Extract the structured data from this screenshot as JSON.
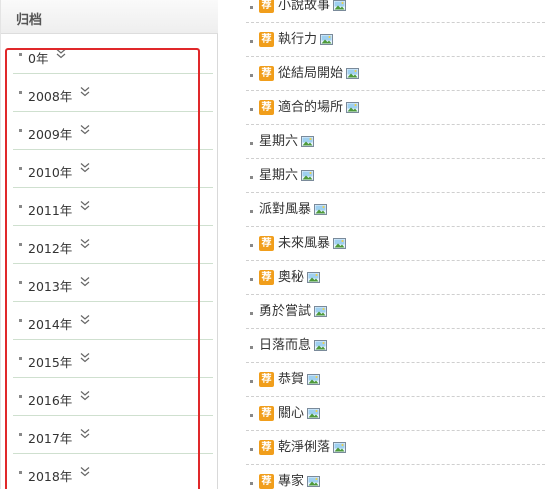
{
  "sidebar": {
    "title": "归档",
    "years": [
      "0年",
      "2008年",
      "2009年",
      "2010年",
      "2011年",
      "2012年",
      "2013年",
      "2014年",
      "2015年",
      "2016年",
      "2017年",
      "2018年"
    ]
  },
  "posts": [
    {
      "title": "小說故事",
      "recommended": true,
      "badge": "荐"
    },
    {
      "title": "執行力",
      "recommended": true,
      "badge": "荐"
    },
    {
      "title": "從結局開始",
      "recommended": true,
      "badge": "荐"
    },
    {
      "title": "適合的場所",
      "recommended": true,
      "badge": "荐"
    },
    {
      "title": "星期六",
      "recommended": false
    },
    {
      "title": "星期六",
      "recommended": false
    },
    {
      "title": "派對風暴",
      "recommended": false
    },
    {
      "title": "未來風暴",
      "recommended": true,
      "badge": "荐"
    },
    {
      "title": "奧秘",
      "recommended": true,
      "badge": "荐"
    },
    {
      "title": "勇於嘗試",
      "recommended": false
    },
    {
      "title": "日落而息",
      "recommended": false
    },
    {
      "title": "恭賀",
      "recommended": true,
      "badge": "荐"
    },
    {
      "title": "關心",
      "recommended": true,
      "badge": "荐"
    },
    {
      "title": "乾淨俐落",
      "recommended": true,
      "badge": "荐"
    },
    {
      "title": "專家",
      "recommended": true,
      "badge": "荐"
    }
  ],
  "colors": {
    "badge": "#f19e1b",
    "highlight": "#e0282a",
    "divider": "#cfe0cf"
  },
  "icons": {
    "expand": "chevron-double-down-icon",
    "attachment": "image-icon"
  }
}
